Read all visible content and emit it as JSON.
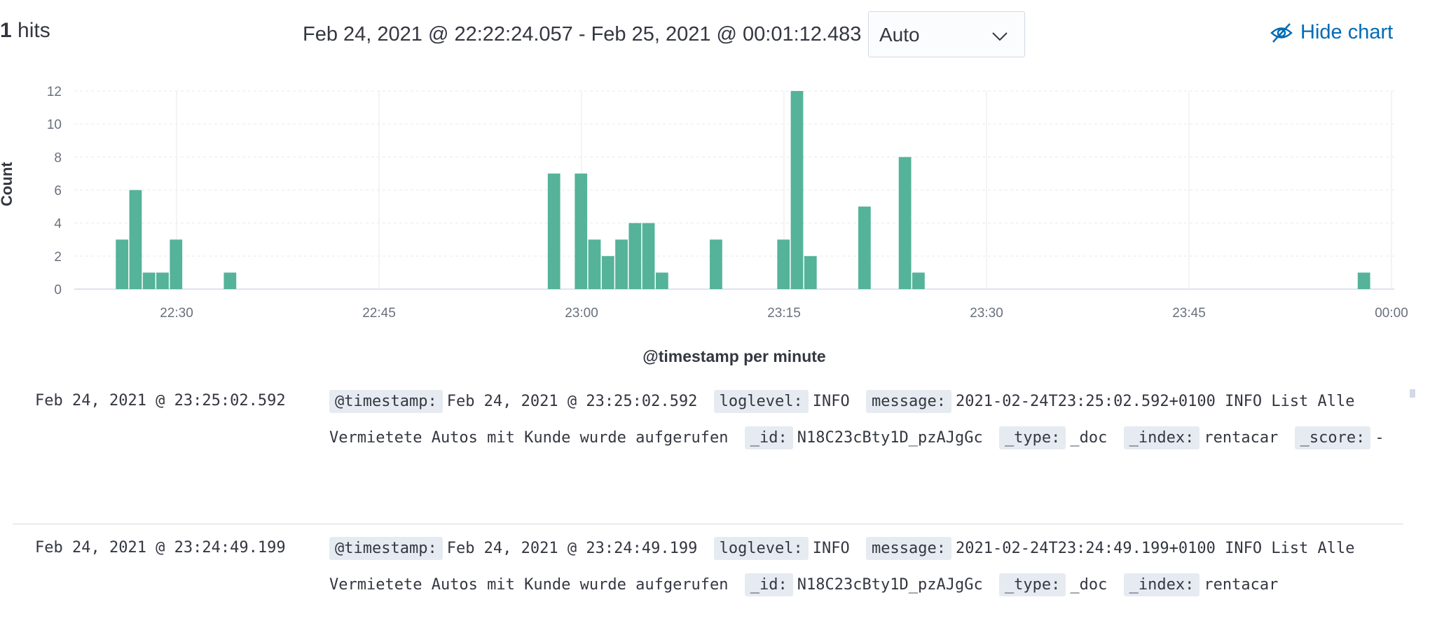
{
  "header": {
    "hits_count_visible": "1",
    "hits_label": "hits",
    "time_range": "Feb 24, 2021 @ 22:22:24.057 - Feb 25, 2021 @ 00:01:12.483",
    "interval": "Auto",
    "hide_chart_label": "Hide chart"
  },
  "chart": {
    "x_axis_title": "@timestamp per minute",
    "y_axis_title_fragment": "Count"
  },
  "chart_data": {
    "type": "bar",
    "xlabel": "@timestamp per minute",
    "ylim": [
      0,
      12
    ],
    "yticks": [
      0,
      2,
      4,
      6,
      8,
      10,
      12
    ],
    "xticks": [
      "22:30",
      "22:45",
      "23:00",
      "23:15",
      "23:30",
      "23:45",
      "00:00"
    ],
    "grid": true,
    "series": [
      {
        "values": [
          {
            "x": "22:26",
            "y": 3
          },
          {
            "x": "22:27",
            "y": 6
          },
          {
            "x": "22:28",
            "y": 1
          },
          {
            "x": "22:29",
            "y": 1
          },
          {
            "x": "22:30",
            "y": 3
          },
          {
            "x": "22:34",
            "y": 1
          },
          {
            "x": "22:58",
            "y": 7
          },
          {
            "x": "23:00",
            "y": 7
          },
          {
            "x": "23:01",
            "y": 3
          },
          {
            "x": "23:02",
            "y": 2
          },
          {
            "x": "23:03",
            "y": 3
          },
          {
            "x": "23:04",
            "y": 4
          },
          {
            "x": "23:05",
            "y": 4
          },
          {
            "x": "23:06",
            "y": 1
          },
          {
            "x": "23:10",
            "y": 3
          },
          {
            "x": "23:15",
            "y": 3
          },
          {
            "x": "23:16",
            "y": 12
          },
          {
            "x": "23:17",
            "y": 2
          },
          {
            "x": "23:21",
            "y": 5
          },
          {
            "x": "23:24",
            "y": 8
          },
          {
            "x": "23:25",
            "y": 1
          },
          {
            "x": "23:58",
            "y": 1
          }
        ]
      }
    ]
  },
  "documents": [
    {
      "timestamp": "Feb 24, 2021 @ 23:25:02.592",
      "fields": {
        "k_timestamp": "@timestamp:",
        "v_timestamp": "Feb 24, 2021 @ 23:25:02.592",
        "k_loglevel": "loglevel:",
        "v_loglevel": "INFO",
        "k_message": "message:",
        "v_message": "2021-02-24T23:25:02.592+0100 INFO List Alle Vermietete Autos mit Kunde wurde aufgerufen",
        "k_id": "_id:",
        "v_id": "N18C23cBty1D_pzAJgGc",
        "k_type": "_type:",
        "v_type": "_doc",
        "k_index": "_index:",
        "v_index": "rentacar",
        "k_score": "_score:",
        "v_score": "-"
      }
    },
    {
      "timestamp": "Feb 24, 2021 @ 23:24:49.199",
      "fields": {
        "k_timestamp": "@timestamp:",
        "v_timestamp": "Feb 24, 2021 @ 23:24:49.199",
        "k_loglevel": "loglevel:",
        "v_loglevel": "INFO",
        "k_message": "message:",
        "v_message": "2021-02-24T23:24:49.199+0100 INFO List Alle Vermietete Autos mit Kunde wurde aufgerufen",
        "k_id": "_id:",
        "v_id": "N18C23cBty1D_pzAJgGc",
        "k_type": "_type:",
        "v_type": "_doc",
        "k_index": "_index:",
        "v_index": "rentacar"
      }
    }
  ],
  "colors": {
    "bar": "#54b399",
    "link": "#006bb4",
    "grid": "#eef0f3",
    "field_bg": "#e6ebf2"
  }
}
